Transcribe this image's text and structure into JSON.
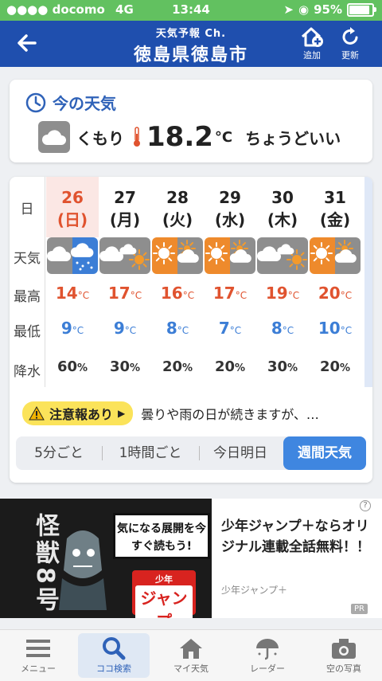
{
  "status_bar": {
    "carrier": "docomo",
    "network": "4G",
    "time": "13:44",
    "battery": "95%"
  },
  "header": {
    "subtitle": "天気予報 Ch.",
    "city": "徳島県徳島市",
    "add_label": "追加",
    "refresh_label": "更新"
  },
  "now": {
    "title": "今の天気",
    "condition": "くもり",
    "temp": "18.2",
    "unit": "°C",
    "comfort": "ちょうどいい"
  },
  "forecast": {
    "row_labels": {
      "day": "日",
      "weather": "天気",
      "high": "最高",
      "low": "最低",
      "rain": "降水"
    },
    "days": [
      {
        "date": "26",
        "weekday": "(日)",
        "weather": "cloudy-rain",
        "high": "14",
        "low": "9",
        "rain": "60"
      },
      {
        "date": "27",
        "weekday": "(月)",
        "weather": "cloudy-sunny",
        "high": "17",
        "low": "9",
        "rain": "30"
      },
      {
        "date": "28",
        "weekday": "(火)",
        "weather": "sunny-cloudy",
        "high": "16",
        "low": "8",
        "rain": "20"
      },
      {
        "date": "29",
        "weekday": "(水)",
        "weather": "sunny-cloudy",
        "high": "17",
        "low": "7",
        "rain": "20"
      },
      {
        "date": "30",
        "weekday": "(木)",
        "weather": "cloudy-sunny",
        "high": "19",
        "low": "8",
        "rain": "30"
      },
      {
        "date": "31",
        "weekday": "(金)",
        "weather": "sunny-cloudy",
        "high": "20",
        "low": "10",
        "rain": "20"
      }
    ],
    "temp_unit": "°C",
    "rain_unit": "%",
    "alert_badge": "注意報あり",
    "alert_text": "曇りや雨の日が続きますが、…",
    "tabs": [
      "5分ごと",
      "1時間ごと",
      "今日明日",
      "週間天気"
    ],
    "active_tab": "週間天気"
  },
  "ad": {
    "title_vertical": "怪獣8号",
    "hook": "気になる展開を今すぐ読もう!",
    "logo_small": "少年",
    "logo_big": "ジャンプ",
    "text": "少年ジャンプ＋ならオリジナル連載全話無料！！",
    "source": "少年ジャンプ＋",
    "pr": "PR"
  },
  "bottom_nav": [
    {
      "label": "メニュー",
      "icon": "menu-icon"
    },
    {
      "label": "ココ検索",
      "icon": "search-icon"
    },
    {
      "label": "マイ天気",
      "icon": "home-icon"
    },
    {
      "label": "レーダー",
      "icon": "umbrella-icon"
    },
    {
      "label": "空の写真",
      "icon": "camera-icon"
    }
  ],
  "colors": {
    "header": "#1f4fae",
    "status": "#62c160",
    "high": "#e0532f",
    "low": "#3c7ed6",
    "accent": "#3f86e0"
  }
}
